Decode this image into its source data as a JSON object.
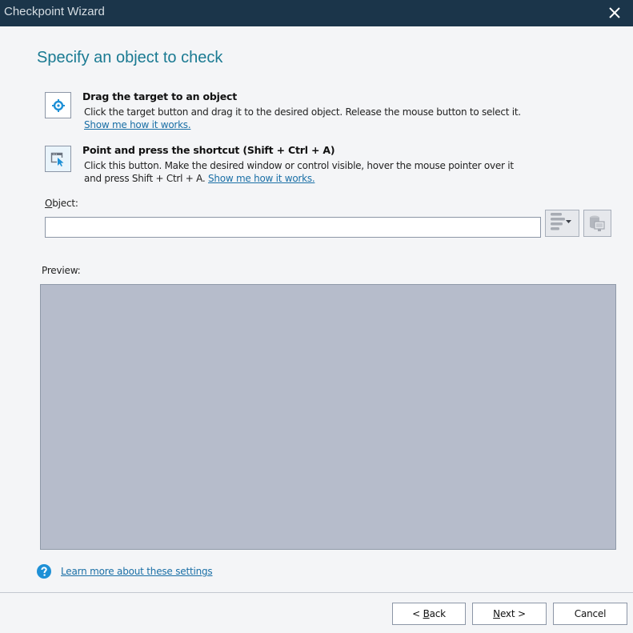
{
  "window": {
    "title": "Checkpoint Wizard",
    "close_icon": "close-icon"
  },
  "heading": "Specify an object to check",
  "methods": [
    {
      "icon": "crosshair-target-icon",
      "title": "Drag the target to an object",
      "description": "Click the target button and drag it to the desired object. Release the mouse button to select it.",
      "link": "Show me how it works."
    },
    {
      "icon": "window-pointer-icon",
      "title": "Point and press the shortcut (Shift + Ctrl + A)",
      "description_line1": "Click this button. Make the desired window or control visible, hover the mouse pointer over it",
      "description_line2": "and press Shift + Ctrl + A.",
      "link": "Show me how it works."
    }
  ],
  "object": {
    "label_accel": "O",
    "label_rest": "bject:",
    "value": "",
    "placeholder": ""
  },
  "tools": {
    "object_tree_icon": "object-tree-dropdown-icon",
    "object_browser_icon": "object-browser-icon"
  },
  "preview": {
    "label": "Preview:"
  },
  "help": {
    "icon": "help-icon",
    "link": "Learn more about these settings"
  },
  "buttons": {
    "back_prefix": "< ",
    "back_accel": "B",
    "back_rest": "ack",
    "next_accel": "N",
    "next_rest": "ext >",
    "cancel": "Cancel"
  },
  "colors": {
    "titlebar": "#1b354a",
    "heading": "#1a7a92",
    "link": "#1a6fa6",
    "preview_bg": "#b6bccb",
    "accent_icon": "#1e90d6"
  }
}
